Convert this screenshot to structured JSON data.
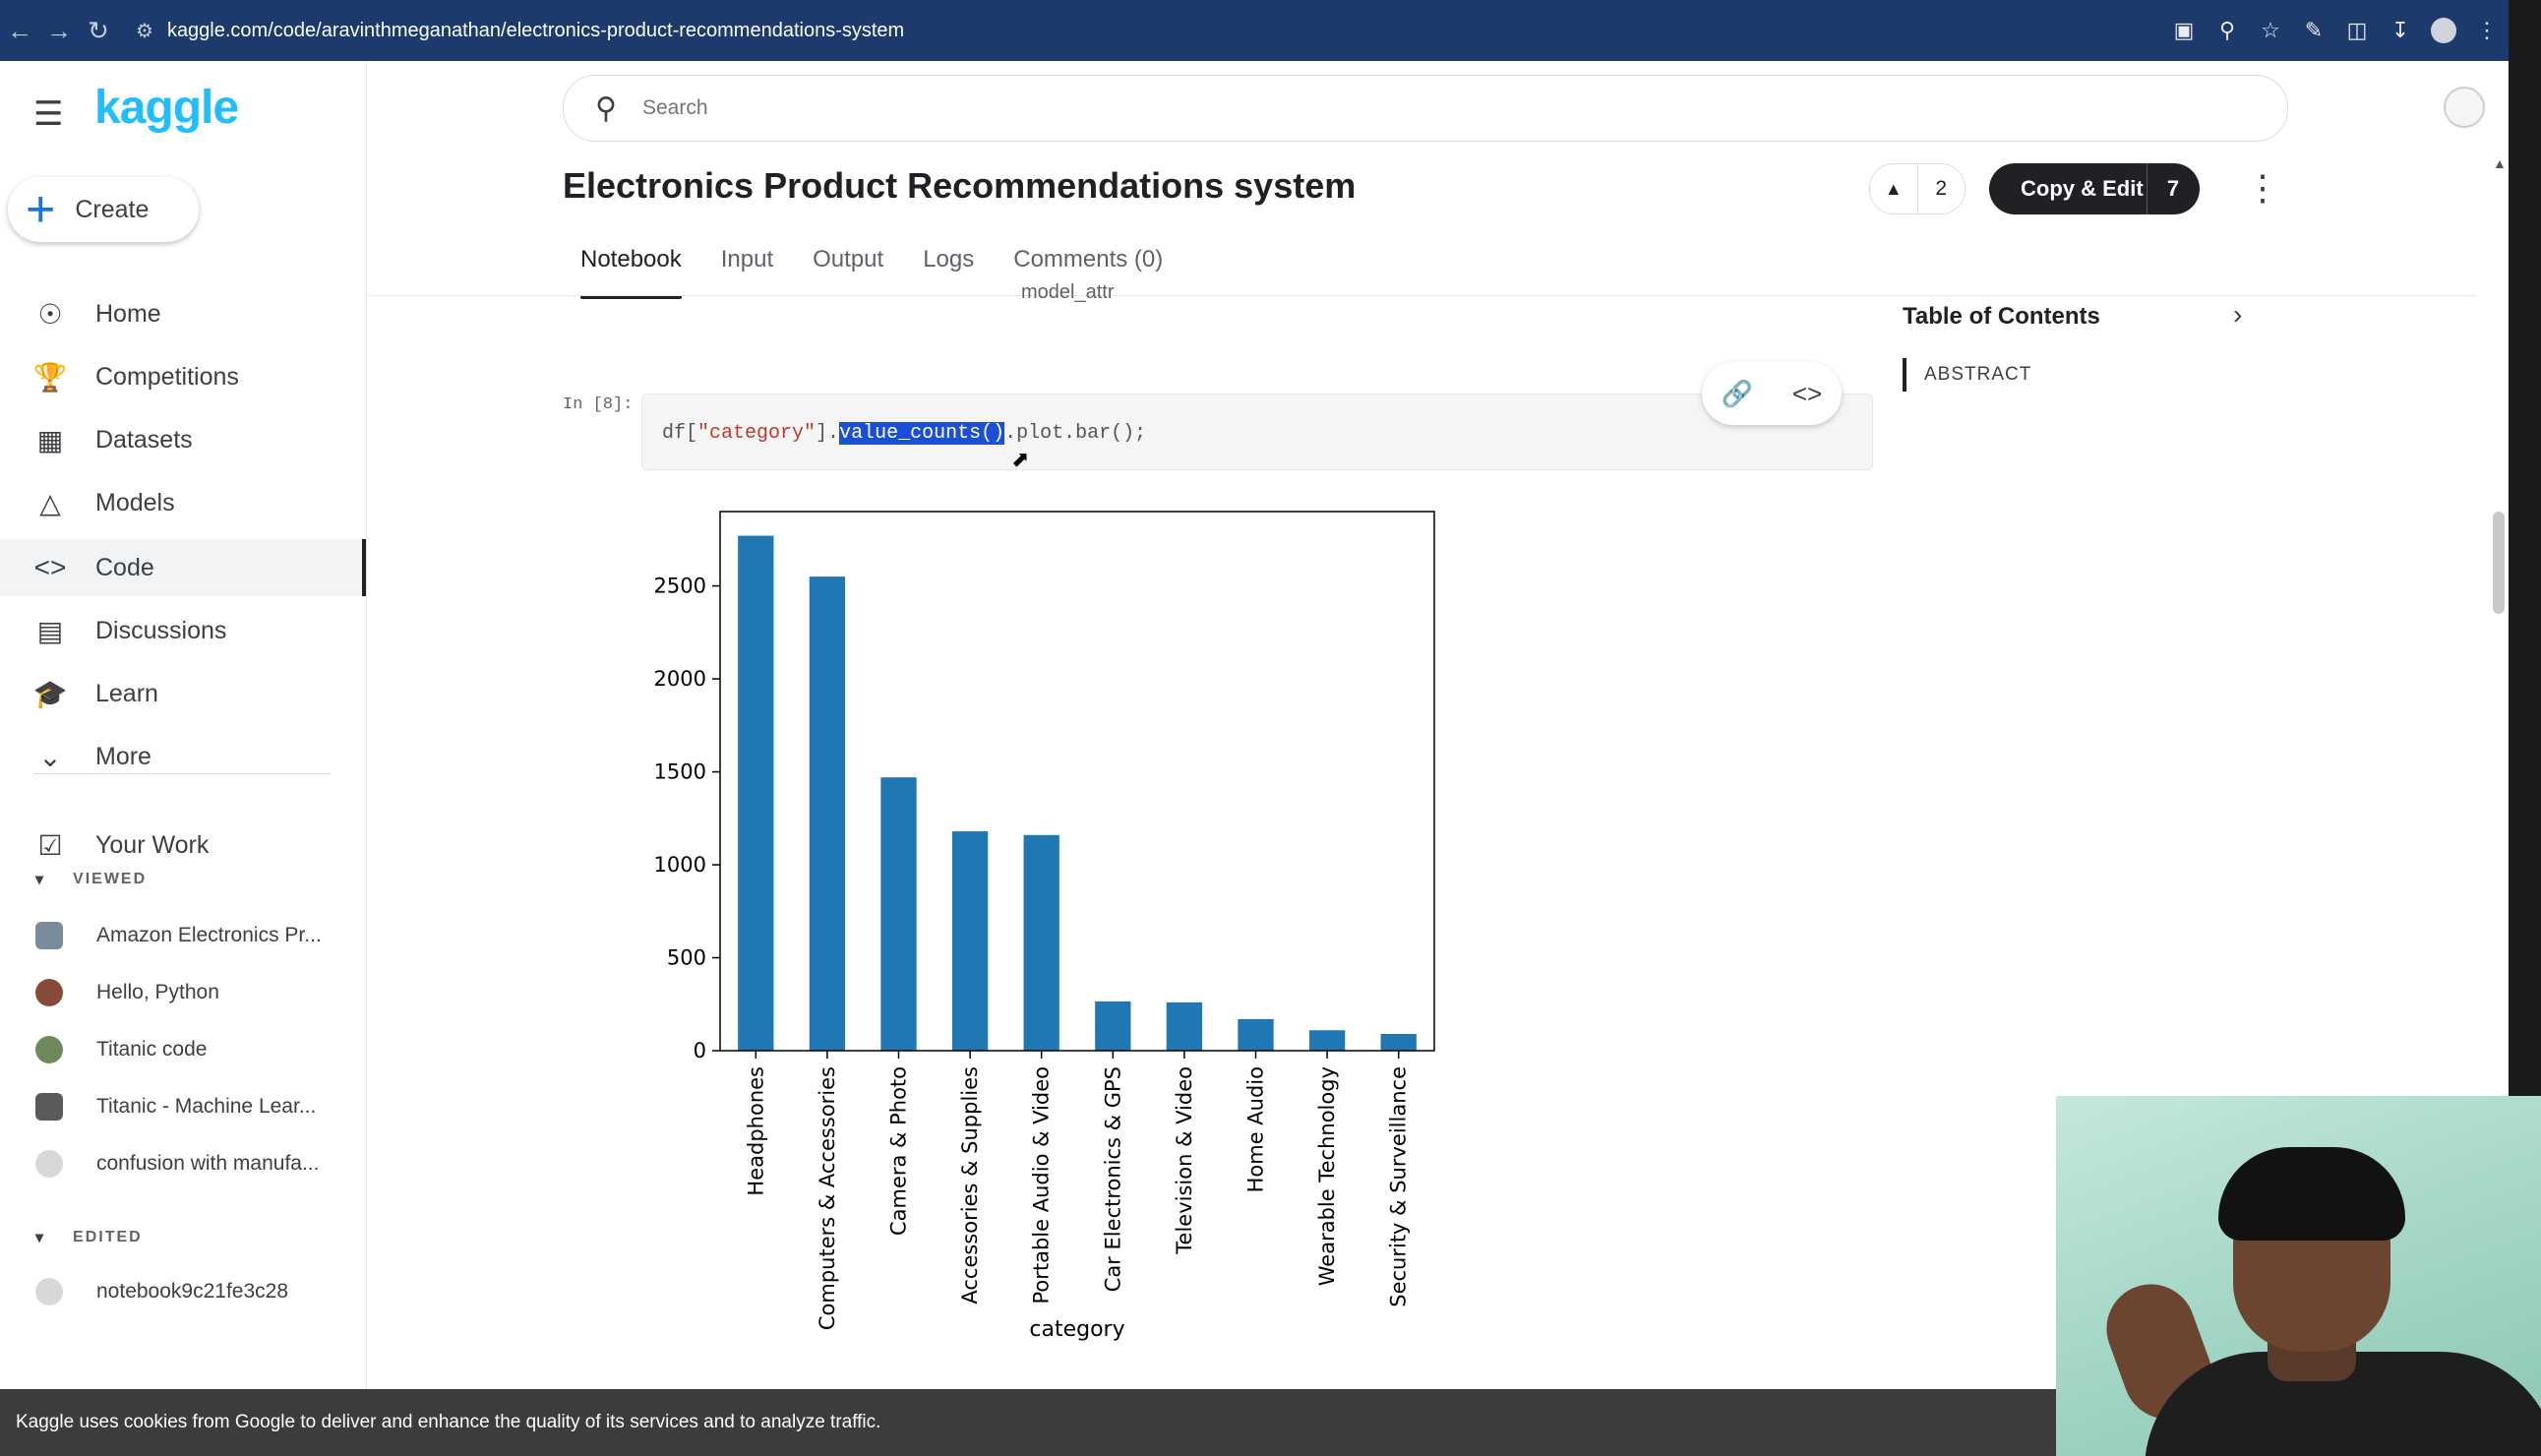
{
  "browser": {
    "url": "kaggle.com/code/aravinthmeganathan/electronics-product-recommendations-system"
  },
  "app": {
    "logo": "kaggle"
  },
  "sidebar": {
    "create_label": "Create",
    "items": [
      {
        "label": "Home",
        "icon": "compass-icon"
      },
      {
        "label": "Competitions",
        "icon": "trophy-icon"
      },
      {
        "label": "Datasets",
        "icon": "table-icon"
      },
      {
        "label": "Models",
        "icon": "models-icon"
      },
      {
        "label": "Code",
        "icon": "code-icon"
      },
      {
        "label": "Discussions",
        "icon": "discussion-icon"
      },
      {
        "label": "Learn",
        "icon": "graduation-cap-icon"
      },
      {
        "label": "More",
        "icon": "chevron-down-icon"
      }
    ],
    "active_item": "Code",
    "your_work": "Your Work",
    "viewed_header": "VIEWED",
    "viewed": [
      "Amazon Electronics Pr...",
      "Hello, Python",
      "Titanic code",
      "Titanic - Machine Lear...",
      "confusion with manufa..."
    ],
    "edited_header": "EDITED",
    "edited": [
      "notebook9c21fe3c28"
    ]
  },
  "header": {
    "search_placeholder": "Search",
    "title": "Electronics Product Recommendations system",
    "upvotes": "2",
    "copy_edit_label": "Copy & Edit",
    "copy_edit_count": "7",
    "tabs": [
      "Notebook",
      "Input",
      "Output",
      "Logs",
      "Comments (0)"
    ],
    "active_tab": "Notebook"
  },
  "notebook": {
    "truncated_text": "model_attr",
    "prompt": "In [8]:",
    "code_prefix": "df[",
    "code_string": "\"category\"",
    "code_mid": "].",
    "code_highlight": "value_counts()",
    "code_suffix": ".plot.bar();"
  },
  "toc": {
    "title": "Table of Contents",
    "items": [
      "ABSTRACT"
    ]
  },
  "cookie_banner": "Kaggle uses cookies from Google to deliver and enhance the quality of its services and to analyze traffic.",
  "chart_data": {
    "type": "bar",
    "categories": [
      "Headphones",
      "Computers & Accessories",
      "Camera & Photo",
      "Accessories & Supplies",
      "Portable Audio & Video",
      "Car Electronics & GPS",
      "Television & Video",
      "Home Audio",
      "Wearable Technology",
      "Security & Surveillance"
    ],
    "values": [
      2770,
      2550,
      1470,
      1180,
      1160,
      265,
      260,
      170,
      110,
      90
    ],
    "xlabel": "category",
    "ylabel": "",
    "ylim": [
      0,
      2900
    ],
    "yticks": [
      0,
      500,
      1000,
      1500,
      2000,
      2500
    ],
    "bar_color": "#1f77b4",
    "grid": false
  }
}
